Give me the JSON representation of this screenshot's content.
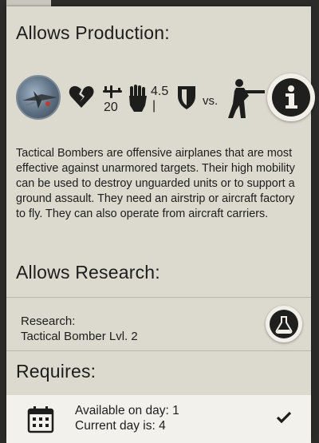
{
  "production": {
    "heading": "Allows Production:",
    "stats": {
      "speed": "20",
      "attack": "4.5",
      "attack_sub": "|",
      "vs_label": "vs."
    },
    "description": "Tactical Bombers are offensive airplanes that are most effective against unarmored targets. Their high mobility can be used to destroy unguarded units or to support a ground assault. They need an airstrip or aircraft factory to fly. They can also operate from aircraft carriers."
  },
  "research": {
    "heading": "Allows Research:",
    "label": "Research:",
    "name": "Tactical Bomber Lvl. 2"
  },
  "requires": {
    "heading": "Requires:",
    "available": "Available on day: 1",
    "current": "Current day is: 4"
  },
  "colors": {
    "panel": "#dcd9cf",
    "dark": "#1f1f1d",
    "card": "#f3f1eb"
  }
}
